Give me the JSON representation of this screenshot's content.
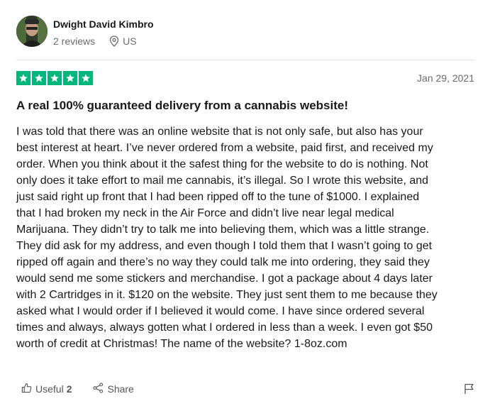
{
  "reviewer": {
    "name": "Dwight David Kimbro",
    "reviews": "2 reviews",
    "location": "US"
  },
  "review": {
    "rating": 5,
    "date": "Jan 29, 2021",
    "title": "A real 100% guaranteed delivery from a cannabis website!",
    "body": "I was told that there was an online website that is not only safe, but also has your\nbest interest at heart. I’ve never ordered from a website, paid first, and received my\norder. When you think about it the safest thing for the website to do is nothing. Not\nonly does it take effort to mail me cannabis, it’s illegal. So I wrote this website, and\njust said right up front that I had been ripped off to the tune of $1000. I explained\nthat I had broken my neck in the Air Force and didn’t live near legal medical\nMarijuana. They didn’t try to talk me into believing them, which was a little strange.\nThey did ask for my address, and even though I told them that I wasn’t going to get\nripped off again and there’s no way they could talk me into ordering, they said they\nwould send me some stickers and merchandise. I got a package about 4 days later\nwith 2 Cartridges in it. $120 on the website. They just sent them to me because they\nasked what I would order if I believed it would come. I have since ordered several\ntimes and always, always gotten what I ordered in less than a week. I even got $50\nworth of credit at Christmas! The name of the website? 1-8oz.com"
  },
  "actions": {
    "useful_label": "Useful",
    "useful_count": "2",
    "share_label": "Share"
  },
  "colors": {
    "star_green": "#00b67a",
    "text": "#191919",
    "muted": "#6b6b6b"
  },
  "icons": [
    "location-pin-icon",
    "star-icon",
    "thumbs-up-icon",
    "share-icon",
    "flag-icon"
  ]
}
